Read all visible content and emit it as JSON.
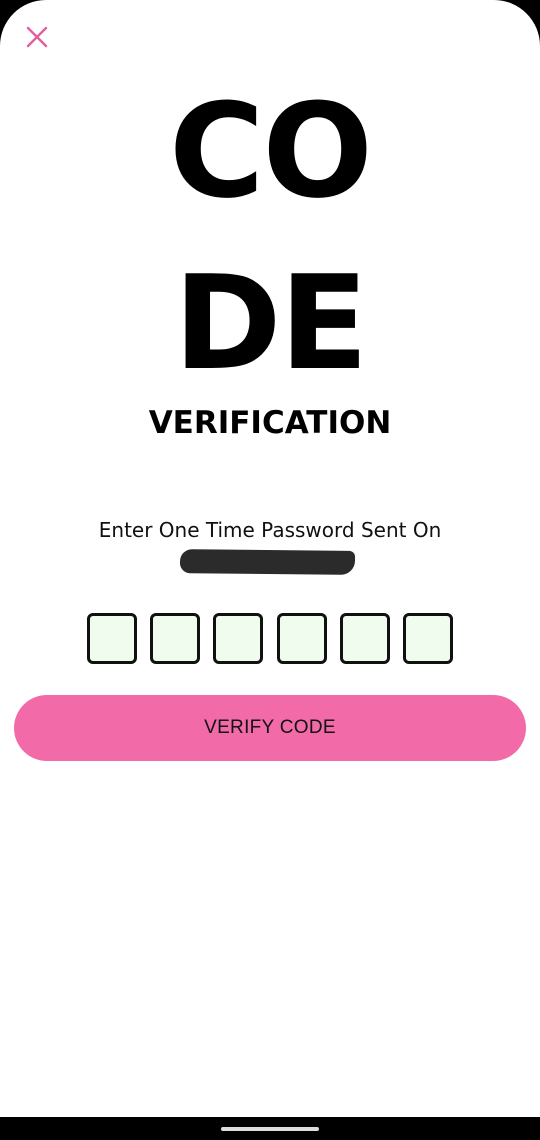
{
  "header": {
    "close_icon": "close-icon",
    "close_color": "#e0609f"
  },
  "title": {
    "line1": "CO",
    "line2": "DE",
    "subtitle": "VERIFICATION"
  },
  "instruction": {
    "text": "Enter One Time Password Sent On"
  },
  "otp": {
    "digits": [
      "",
      "",
      "",
      "",
      "",
      ""
    ],
    "box_background": "#effcee",
    "box_border": "#111111"
  },
  "actions": {
    "verify_label": "VERIFY CODE",
    "verify_color": "#f36aa9"
  }
}
